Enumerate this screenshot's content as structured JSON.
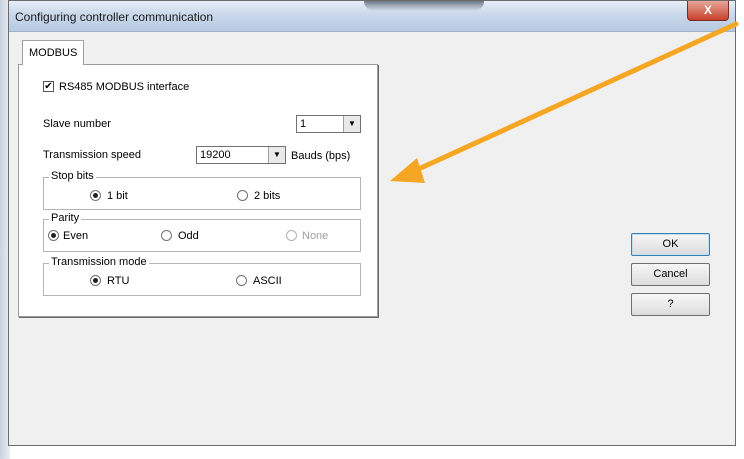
{
  "window": {
    "title": "Configuring controller communication",
    "close_glyph": "X"
  },
  "tabs": [
    {
      "label": "MODBUS"
    }
  ],
  "modbus": {
    "interface_checkbox": {
      "label": "RS485 MODBUS interface",
      "checked": true,
      "mark": "✔"
    },
    "slave_number": {
      "label": "Slave number",
      "value": "1"
    },
    "transmission_speed": {
      "label": "Transmission speed",
      "value": "19200",
      "unit": "Bauds (bps)"
    },
    "stop_bits": {
      "legend": "Stop bits",
      "options": [
        {
          "label": "1 bit",
          "selected": true
        },
        {
          "label": "2 bits",
          "selected": false
        }
      ]
    },
    "parity": {
      "legend": "Parity",
      "options": [
        {
          "label": "Even",
          "selected": true
        },
        {
          "label": "Odd",
          "selected": false
        },
        {
          "label": "None",
          "selected": false,
          "disabled": true
        }
      ]
    },
    "transmission_mode": {
      "legend": "Transmission mode",
      "options": [
        {
          "label": "RTU",
          "selected": true
        },
        {
          "label": "ASCII",
          "selected": false
        }
      ]
    }
  },
  "buttons": {
    "ok": "OK",
    "cancel": "Cancel",
    "help": "?"
  },
  "annotation": {
    "arrow_color": "#f5a623"
  },
  "icons": {
    "dropdown": "chevron-down-icon",
    "annotation": "arrow-annotation"
  }
}
